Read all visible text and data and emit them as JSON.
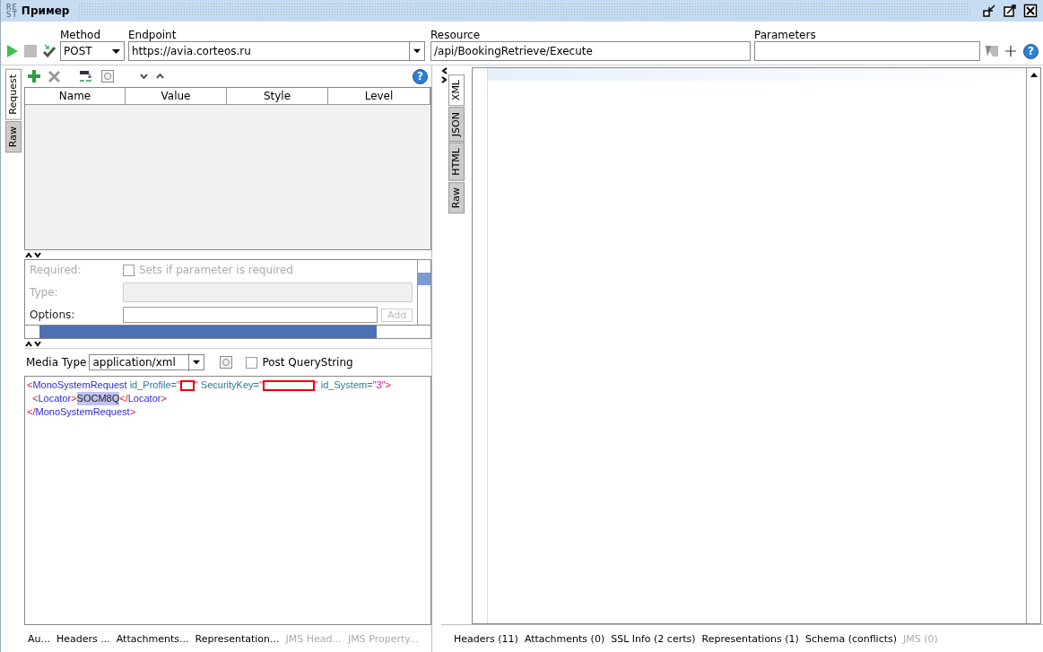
{
  "window": {
    "logo_lines": [
      "RE",
      "ST"
    ],
    "title": "Пример"
  },
  "request_bar": {
    "method": {
      "label": "Method",
      "value": "POST"
    },
    "endpoint": {
      "label": "Endpoint",
      "value": "https://avia.corteos.ru"
    },
    "resource": {
      "label": "Resource",
      "value": "/api/BookingRetrieve/Execute"
    },
    "parameters": {
      "label": "Parameters"
    },
    "help": "?"
  },
  "request_tabs": [
    {
      "label": "Request",
      "selected": true
    },
    {
      "label": "Raw",
      "selected": false
    }
  ],
  "params_toolbar": {
    "help": "?"
  },
  "params_table": {
    "columns": [
      "Name",
      "Value",
      "Style",
      "Level"
    ]
  },
  "param_form": {
    "required_label": "Required:",
    "required_checkbox": {
      "label": "Sets if parameter is required",
      "checked": false
    },
    "type_label": "Type:",
    "options_label": "Options:",
    "add_button": "Add"
  },
  "media": {
    "label": "Media Type",
    "value": "application/xml",
    "post_querystring": {
      "label": "Post QueryString",
      "checked": false
    }
  },
  "body_lines": [
    [
      {
        "kind": "punct",
        "text": "<"
      },
      {
        "kind": "tag",
        "text": "MonoSystemRequest"
      },
      {
        "kind": "attr",
        "text": " id_Profile="
      },
      {
        "kind": "value",
        "text": "\""
      },
      {
        "kind": "redacted_short"
      },
      {
        "kind": "value",
        "text": "\""
      },
      {
        "kind": "attr",
        "text": " SecurityKey="
      },
      {
        "kind": "value",
        "text": "\""
      },
      {
        "kind": "redacted_long"
      },
      {
        "kind": "value",
        "text": "\""
      },
      {
        "kind": "attr",
        "text": " id_System="
      },
      {
        "kind": "value",
        "text": "\"3\""
      },
      {
        "kind": "punct",
        "text": ">"
      }
    ],
    [
      {
        "kind": "indent"
      },
      {
        "kind": "punct",
        "text": "<"
      },
      {
        "kind": "tag",
        "text": "Locator"
      },
      {
        "kind": "punct",
        "text": ">"
      },
      {
        "kind": "highlight",
        "text": "SOCM8Q"
      },
      {
        "kind": "punct",
        "text": "</"
      },
      {
        "kind": "tag",
        "text": "Locator"
      },
      {
        "kind": "punct",
        "text": ">"
      }
    ],
    [
      {
        "kind": "punct",
        "text": "</"
      },
      {
        "kind": "tag",
        "text": "MonoSystemRequest"
      },
      {
        "kind": "punct",
        "text": ">"
      }
    ]
  ],
  "request_bottom_tabs": [
    {
      "label": "Au...",
      "disabled": false
    },
    {
      "label": "Headers ...",
      "disabled": false
    },
    {
      "label": "Attachments...",
      "disabled": false
    },
    {
      "label": "Representation...",
      "disabled": false
    },
    {
      "label": "JMS Head...",
      "disabled": true
    },
    {
      "label": "JMS Property...",
      "disabled": true
    }
  ],
  "response_tabs": [
    {
      "label": "XML",
      "selected": true
    },
    {
      "label": "JSON",
      "selected": false
    },
    {
      "label": "HTML",
      "selected": false
    },
    {
      "label": "Raw",
      "selected": false
    }
  ],
  "response_bottom_tabs": [
    {
      "label": "Headers (11)",
      "disabled": false
    },
    {
      "label": "Attachments (0)",
      "disabled": false
    },
    {
      "label": "SSL Info (2 certs)",
      "disabled": false
    },
    {
      "label": "Representations (1)",
      "disabled": false
    },
    {
      "label": "Schema (conflicts)",
      "disabled": false
    },
    {
      "label": "JMS (0)",
      "disabled": true
    }
  ]
}
